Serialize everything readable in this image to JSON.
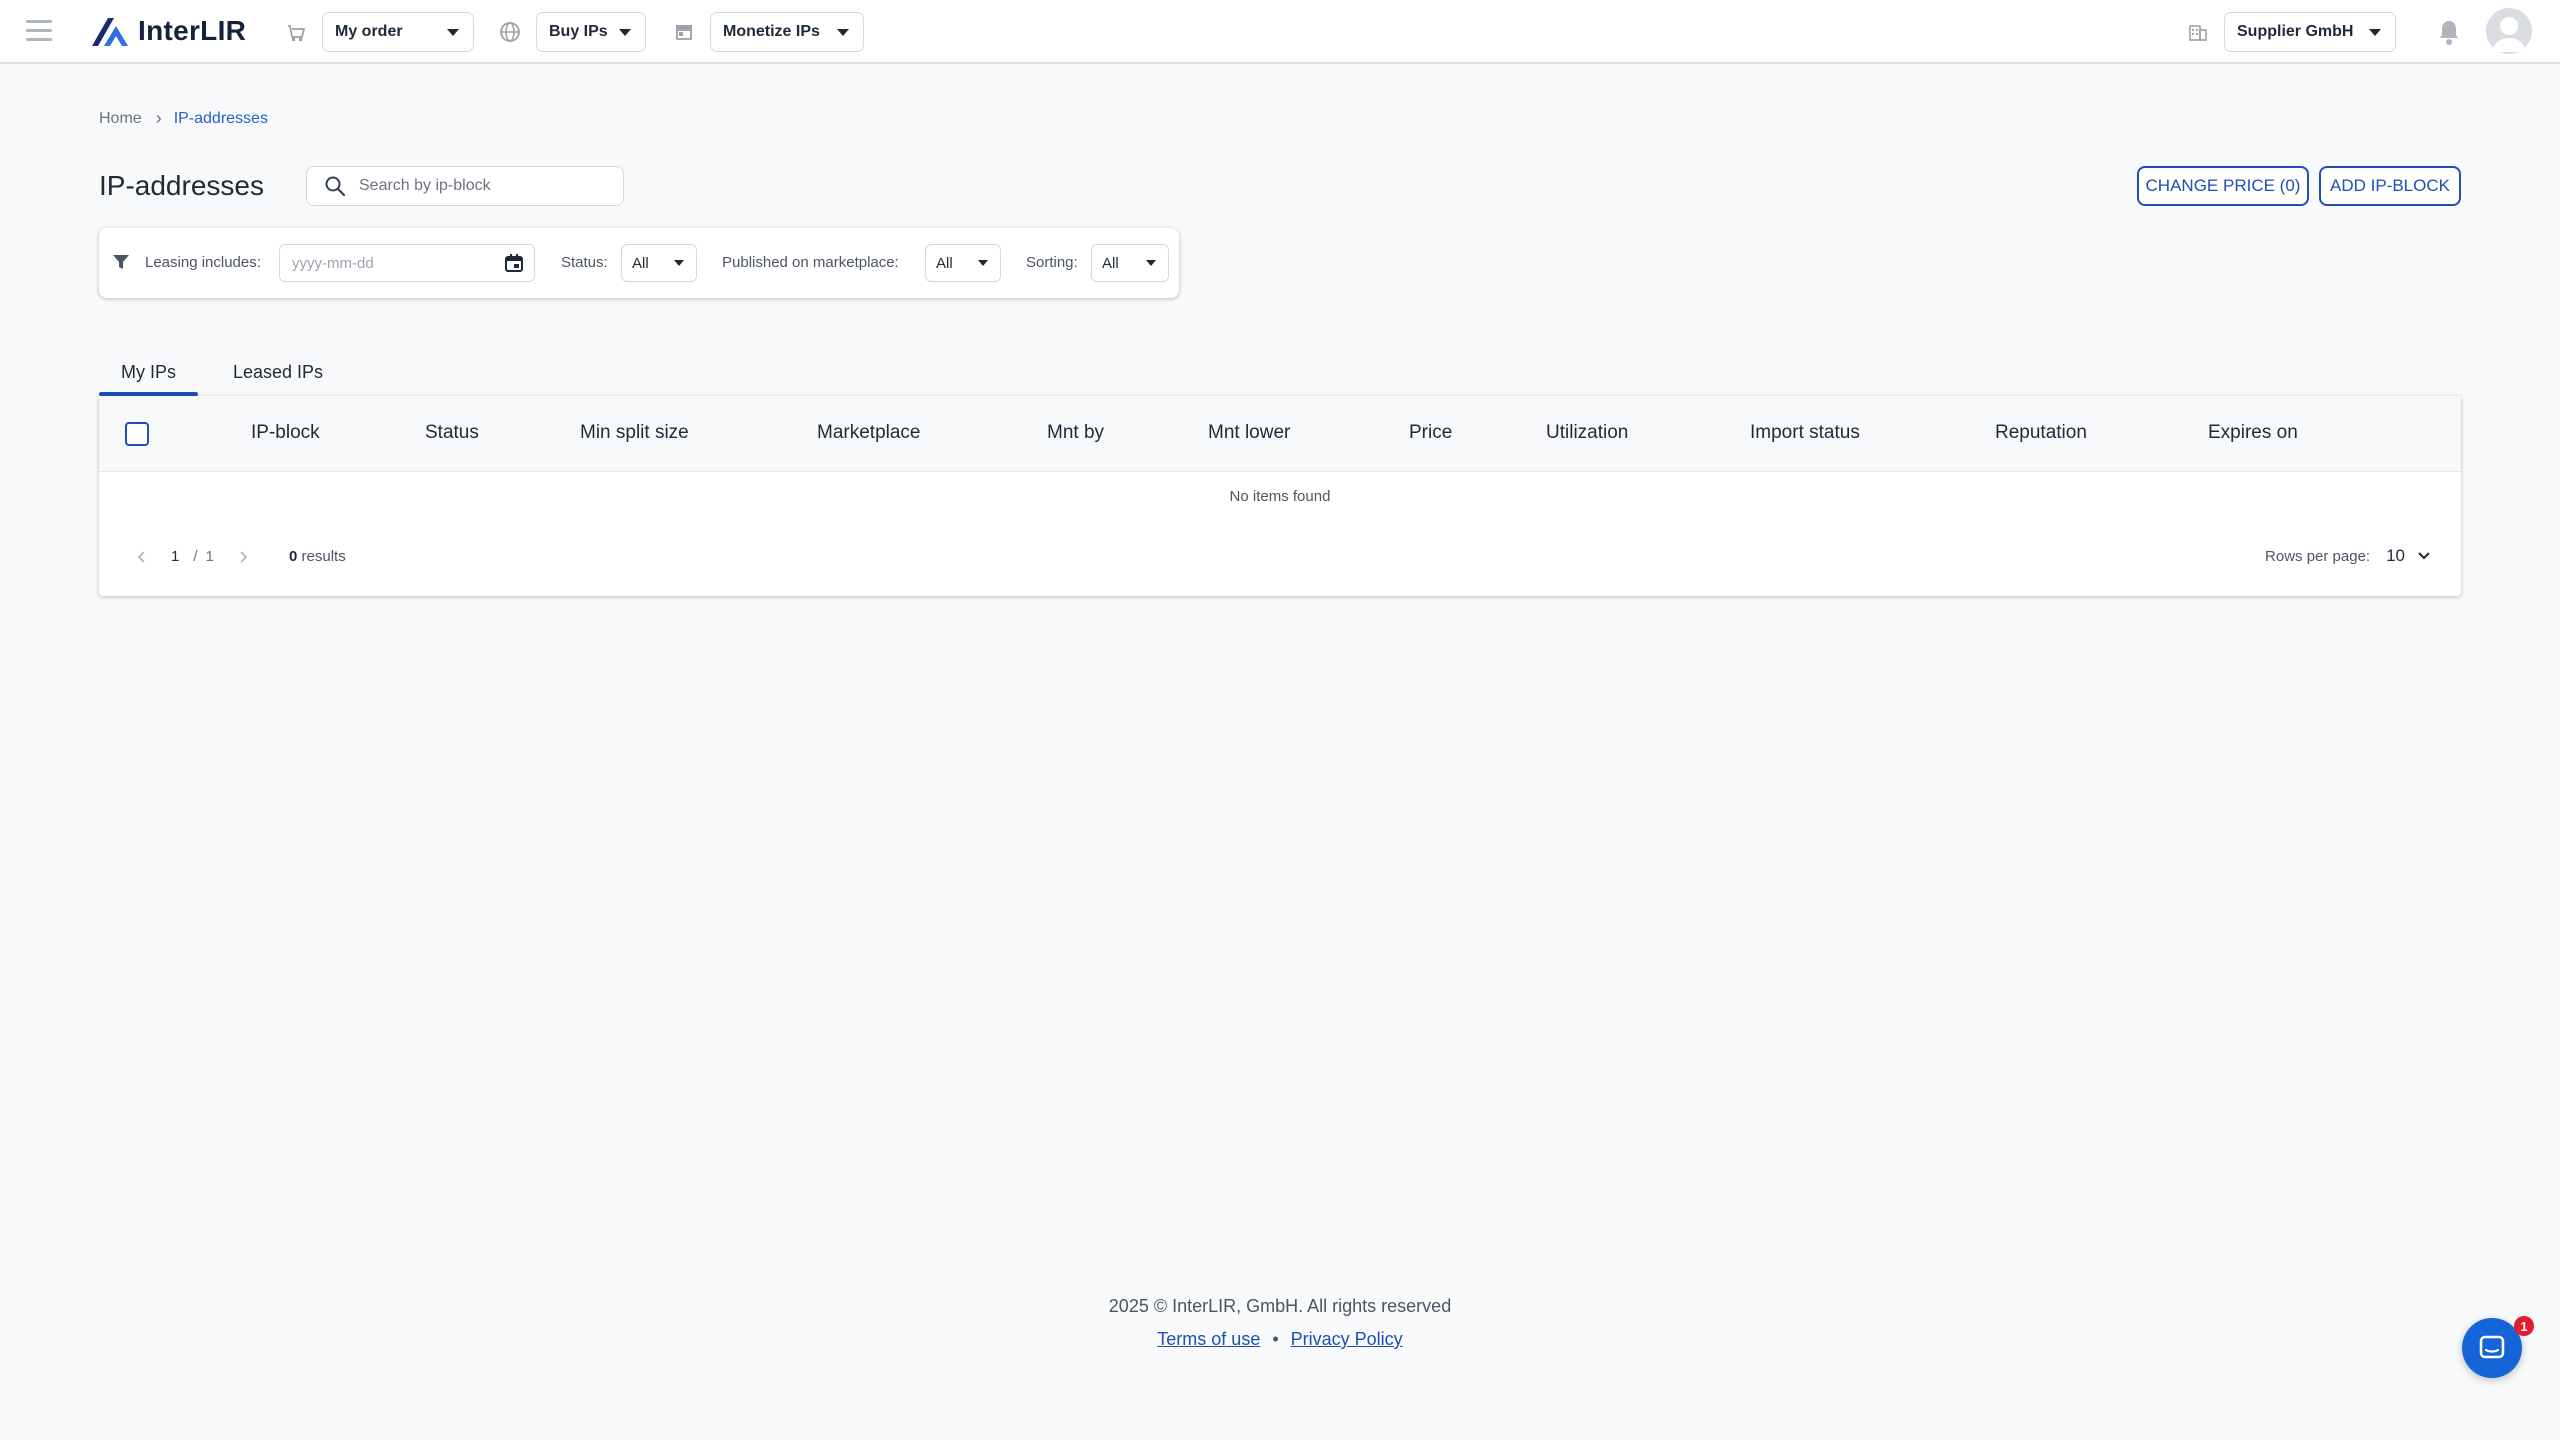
{
  "header": {
    "logo_text": "InterLIR",
    "nav": [
      {
        "label": "My order",
        "icon": "cart-icon"
      },
      {
        "label": "Buy IPs",
        "icon": "globe-icon"
      },
      {
        "label": "Monetize IPs",
        "icon": "store-icon"
      }
    ],
    "company": {
      "label": "Supplier GmbH",
      "icon": "building-icon"
    }
  },
  "breadcrumb": {
    "home": "Home",
    "current": "IP-addresses"
  },
  "page": {
    "title": "IP-addresses",
    "search_placeholder": "Search by ip-block",
    "change_price_label": "CHANGE PRICE (0)",
    "add_block_label": "ADD IP-BLOCK"
  },
  "filters": {
    "leasing_label": "Leasing includes:",
    "date_placeholder": "yyyy-mm-dd",
    "status_label": "Status:",
    "status_value": "All",
    "published_label": "Published on marketplace:",
    "published_value": "All",
    "sorting_label": "Sorting:",
    "sorting_value": "All"
  },
  "tabs": [
    {
      "label": "My IPs",
      "active": true
    },
    {
      "label": "Leased IPs",
      "active": false
    }
  ],
  "table": {
    "columns": [
      "IP-block",
      "Status",
      "Min split size",
      "Marketplace",
      "Mnt by",
      "Mnt lower",
      "Price",
      "Utilization",
      "Import status",
      "Reputation",
      "Expires on"
    ],
    "empty_text": "No items found",
    "page_current": "1",
    "page_sep": "/",
    "page_total": "1",
    "results_count": "0",
    "results_label": "results",
    "rows_per_page_label": "Rows per page:",
    "rows_per_page_value": "10"
  },
  "footer": {
    "copyright": "2025 © InterLIR, GmbH. All rights reserved",
    "terms": "Terms of use",
    "dot": "•",
    "privacy": "Privacy Policy"
  },
  "chat": {
    "badge": "1"
  },
  "colors": {
    "accent": "#1e4fb4",
    "link": "#2563c9",
    "chat": "#1565d8",
    "badge": "#e11d2e"
  }
}
